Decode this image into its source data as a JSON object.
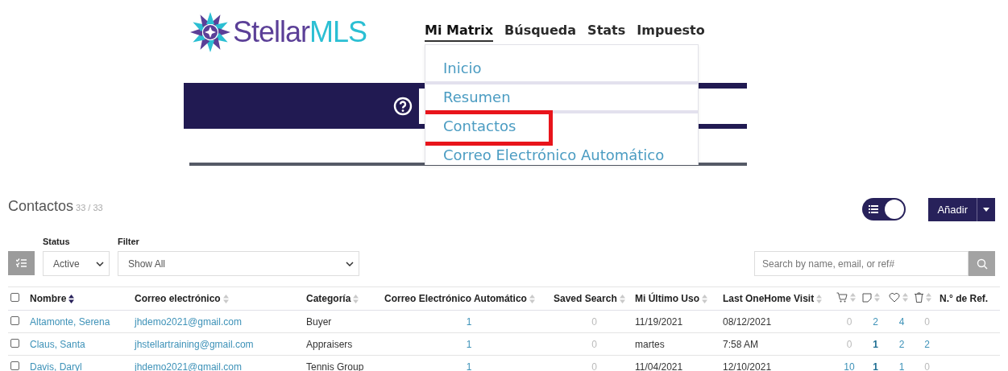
{
  "header": {
    "logo": {
      "word_1": "Stellar",
      "word_2": "MLS"
    },
    "nav": [
      {
        "label": "Mi Matrix",
        "selected": true
      },
      {
        "label": "Búsqueda",
        "selected": false
      },
      {
        "label": "Stats",
        "selected": false
      },
      {
        "label": "Impuesto",
        "selected": false
      }
    ],
    "menu": [
      {
        "label": "Inicio",
        "highlighted": false
      },
      {
        "label": "Resumen",
        "highlighted": false
      },
      {
        "label": "Contactos",
        "highlighted": true
      },
      {
        "label": "Correo Electrónico Automático",
        "highlighted": false
      }
    ]
  },
  "contacts": {
    "title": "Contactos",
    "count": "33 / 33",
    "view_toggle": {
      "on": true
    },
    "add_button": "Añadir",
    "status": {
      "label": "Status",
      "value": "Active"
    },
    "filter": {
      "label": "Filter",
      "value": "Show All"
    },
    "search": {
      "placeholder": "Search by name, email, or ref#"
    },
    "select_all": {
      "checked": false
    },
    "columns": [
      {
        "kind": "text",
        "label": "Nombre",
        "sort_active": true
      },
      {
        "kind": "text",
        "label": "Correo electrónico",
        "sort_active": false
      },
      {
        "kind": "text",
        "label": "Categoría",
        "sort_active": false
      },
      {
        "kind": "text",
        "label": "Correo Electrónico Automático",
        "sort_active": false
      },
      {
        "kind": "text",
        "label": "Saved Search",
        "sort_active": false
      },
      {
        "kind": "text",
        "label": "Mi Último Uso",
        "sort_active": false
      },
      {
        "kind": "text",
        "label": "Last OneHome Visit",
        "sort_active": false
      },
      {
        "kind": "cart",
        "sort_active": false
      },
      {
        "kind": "note",
        "sort_active": false
      },
      {
        "kind": "heart",
        "sort_active": false
      },
      {
        "kind": "trash",
        "sort_active": false
      },
      {
        "kind": "plain",
        "label": "N.° de Ref."
      }
    ],
    "rows": [
      {
        "checked": false,
        "name": "Altamonte, Serena",
        "email": "jhdemo2021@gmail.com",
        "category": "Buyer",
        "last_use": "11/19/2021",
        "last_visit": "08/12/2021",
        "counts": [
          {
            "text": "1",
            "muted": false,
            "bold": false
          },
          {
            "text": "0",
            "muted": true,
            "bold": false
          },
          {
            "text": "0",
            "muted": true,
            "bold": false
          },
          {
            "text": "2",
            "muted": false,
            "bold": false
          },
          {
            "text": "4",
            "muted": false,
            "bold": false
          },
          {
            "text": "0",
            "muted": true,
            "bold": false
          }
        ]
      },
      {
        "checked": false,
        "name": "Claus, Santa",
        "email": "jhstellartraining@gmail.com",
        "category": "Appraisers",
        "last_use": "martes",
        "last_visit": "7:58 AM",
        "counts": [
          {
            "text": "1",
            "muted": false,
            "bold": false
          },
          {
            "text": "0",
            "muted": true,
            "bold": false
          },
          {
            "text": "0",
            "muted": true,
            "bold": false
          },
          {
            "text": "1",
            "muted": false,
            "bold": true
          },
          {
            "text": "2",
            "muted": false,
            "bold": false
          },
          {
            "text": "2",
            "muted": false,
            "bold": false
          }
        ]
      },
      {
        "checked": false,
        "name": "Davis, Daryl",
        "email": "jhdemo2021@gmail.com",
        "category": "Tennis Group",
        "last_use": "11/04/2021",
        "last_visit": "12/10/2021",
        "counts": [
          {
            "text": "1",
            "muted": false,
            "bold": false
          },
          {
            "text": "0",
            "muted": true,
            "bold": false
          },
          {
            "text": "10",
            "muted": false,
            "bold": false
          },
          {
            "text": "1",
            "muted": false,
            "bold": true
          },
          {
            "text": "1",
            "muted": false,
            "bold": false
          },
          {
            "text": "0",
            "muted": true,
            "bold": false
          }
        ]
      }
    ]
  }
}
